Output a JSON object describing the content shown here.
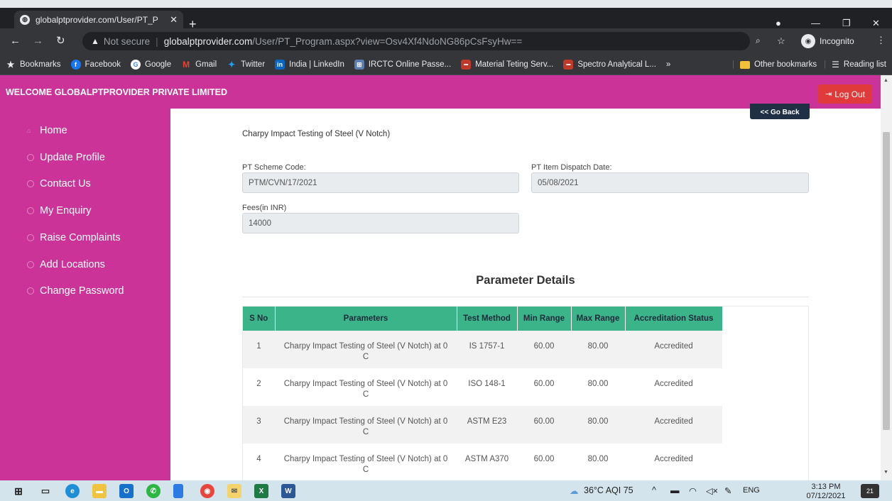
{
  "browser": {
    "tab_title": "globalptprovider.com/User/PT_P",
    "url_warning": "Not secure",
    "url_host": "globalptprovider.com",
    "url_path": "/User/PT_Program.aspx?view=Osv4Xf4NdoNG86pCsFsyHw==",
    "incognito_label": "Incognito",
    "bookmarks": [
      {
        "label": "Bookmarks",
        "icon": "star-icon",
        "color": "#e8eaed"
      },
      {
        "label": "Facebook",
        "icon": "facebook-icon",
        "color": "#1877f2"
      },
      {
        "label": "Google",
        "icon": "google-icon",
        "color": "#4285f4"
      },
      {
        "label": "Gmail",
        "icon": "gmail-icon",
        "color": "#ea4335"
      },
      {
        "label": "Twitter",
        "icon": "twitter-icon",
        "color": "#1da1f2"
      },
      {
        "label": "India | LinkedIn",
        "icon": "linkedin-icon",
        "color": "#0a66c2"
      },
      {
        "label": "IRCTC Online Passe...",
        "icon": "irctc-icon",
        "color": "#5b7db1"
      },
      {
        "label": "Material Teting Serv...",
        "icon": "site-icon",
        "color": "#c0392b"
      },
      {
        "label": "Spectro Analytical L...",
        "icon": "site-icon",
        "color": "#c0392b"
      }
    ],
    "overflow": "»",
    "other_bookmarks": "Other bookmarks",
    "reading_list": "Reading list"
  },
  "header": {
    "welcome": "WELCOME GLOBALPTPROVIDER PRIVATE LIMITED",
    "logout": "Log Out",
    "brand_color": "#cc3399"
  },
  "sidebar": {
    "items": [
      {
        "label": "Home",
        "icon": "home-icon"
      },
      {
        "label": "Update Profile",
        "icon": "circle-icon"
      },
      {
        "label": "Contact Us",
        "icon": "circle-icon"
      },
      {
        "label": "My Enquiry",
        "icon": "circle-icon"
      },
      {
        "label": "Raise Complaints",
        "icon": "circle-icon"
      },
      {
        "label": "Add Locations",
        "icon": "circle-icon"
      },
      {
        "label": "Change Password",
        "icon": "circle-icon"
      }
    ]
  },
  "main": {
    "go_back": "<< Go Back",
    "program_title": "Charpy Impact Testing of Steel (V Notch)",
    "scheme_code_label": "PT Scheme Code:",
    "scheme_code_value": "PTM/CVN/17/2021",
    "dispatch_date_label": "PT Item Dispatch Date:",
    "dispatch_date_value": "05/08/2021",
    "fees_label": "Fees(in INR)",
    "fees_value": "14000",
    "section_title": "Parameter Details",
    "table": {
      "header_color": "#3cb48a",
      "columns": [
        "S No",
        "Parameters",
        "Test Method",
        "Min Range",
        "Max Range",
        "Accreditation Status"
      ],
      "rows": [
        [
          "1",
          "Charpy Impact Testing of Steel (V Notch) at 0 C",
          "IS 1757-1",
          "60.00",
          "80.00",
          "Accredited"
        ],
        [
          "2",
          "Charpy Impact Testing of Steel (V Notch) at 0 C",
          "ISO 148-1",
          "60.00",
          "80.00",
          "Accredited"
        ],
        [
          "3",
          "Charpy Impact Testing of Steel (V Notch) at 0 C",
          "ASTM E23",
          "60.00",
          "80.00",
          "Accredited"
        ],
        [
          "4",
          "Charpy Impact Testing of Steel (V Notch) at 0 C",
          "ASTM A370",
          "60.00",
          "80.00",
          "Accredited"
        ]
      ]
    }
  },
  "taskbar": {
    "weather": "36°C AQI 75",
    "language": "ENG",
    "time": "3:13 PM",
    "date": "07/12/2021",
    "notifications": "21"
  }
}
